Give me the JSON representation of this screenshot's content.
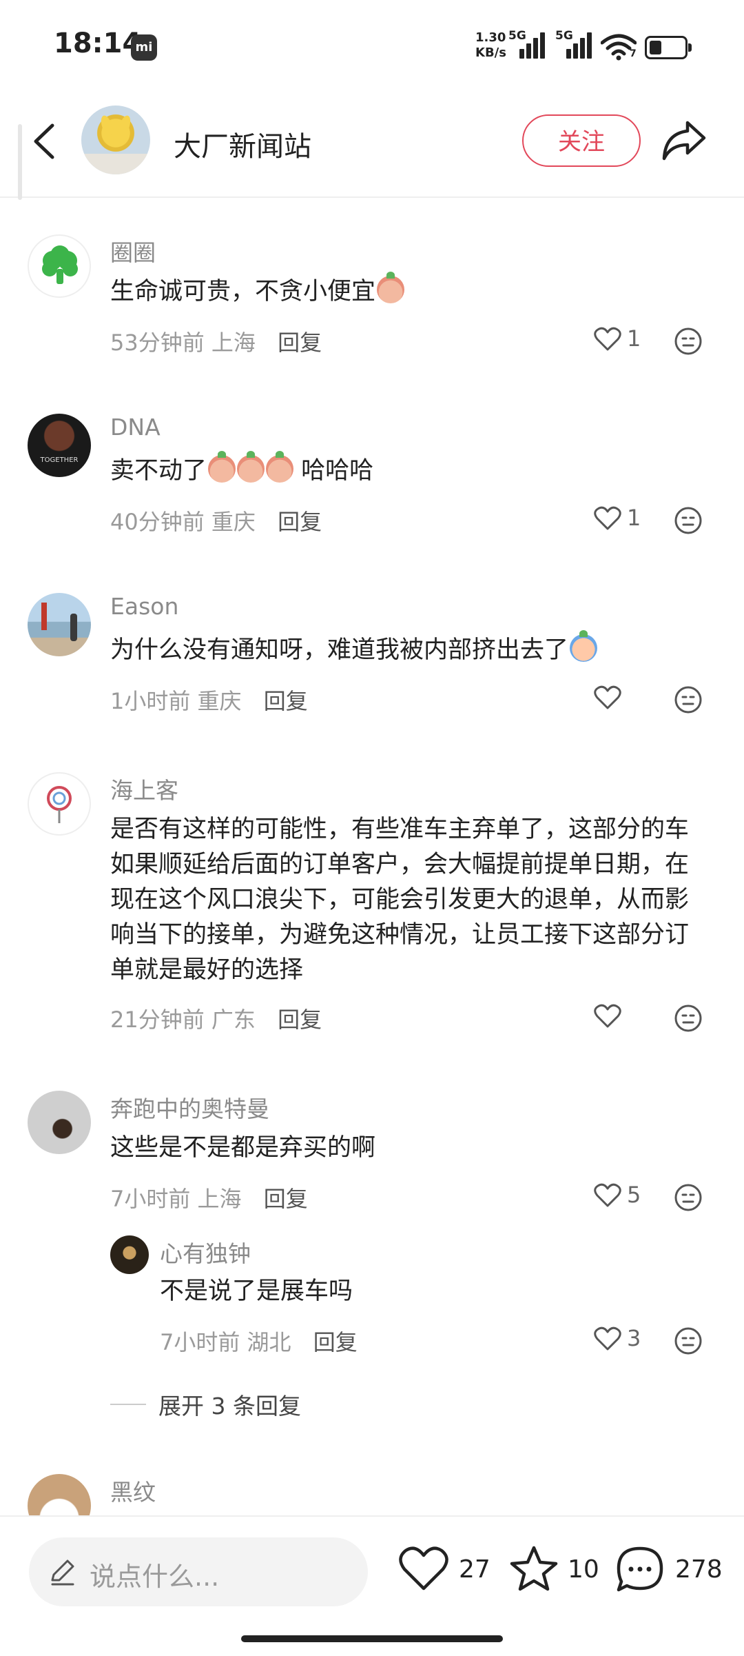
{
  "status_bar": {
    "time": "18:14",
    "mi_badge": "mi",
    "net_speed_value": "1.30",
    "net_speed_unit": "KB/s",
    "sim1_tag": "5G",
    "sim2_tag": "5G",
    "wifi_tag": "7",
    "battery_level": 0.35
  },
  "header": {
    "channel_name": "大厂新闻站",
    "follow_label": "关注"
  },
  "comments": [
    {
      "username": "圈圈",
      "text": "生命诚可贵，不贪小便宜",
      "time": "53分钟前",
      "location": "上海",
      "reply_label": "回复",
      "likes": "1"
    },
    {
      "username": "DNA",
      "text_before": "卖不动了",
      "text_after": "哈哈哈",
      "time": "40分钟前",
      "location": "重庆",
      "reply_label": "回复",
      "likes": "1"
    },
    {
      "username": "Eason",
      "text": "为什么没有通知呀，难道我被内部挤出去了",
      "time": "1小时前",
      "location": "重庆",
      "reply_label": "回复",
      "likes": ""
    },
    {
      "username": "海上客",
      "text": "是否有这样的可能性，有些准车主弃单了，这部分的车如果顺延给后面的订单客户，会大幅提前提单日期，在现在这个风口浪尖下，可能会引发更大的退单，从而影响当下的接单，为避免这种情况，让员工接下这部分订单就是最好的选择",
      "time": "21分钟前",
      "location": "广东",
      "reply_label": "回复",
      "likes": ""
    },
    {
      "username": "奔跑中的奥特曼",
      "text": "这些是不是都是弃买的啊",
      "time": "7小时前",
      "location": "上海",
      "reply_label": "回复",
      "likes": "5",
      "sub_reply": {
        "username": "心有独钟",
        "text": "不是说了是展车吗",
        "time": "7小时前",
        "location": "湖北",
        "reply_label": "回复",
        "likes": "3"
      },
      "expand_label": "展开 3 条回复"
    },
    {
      "username": "黑纹"
    }
  ],
  "bottom_bar": {
    "input_placeholder": "说点什么...",
    "likes_count": "27",
    "favorites_count": "10",
    "comments_count": "278"
  },
  "colors": {
    "accent": "#e2485a",
    "text_primary": "#222222",
    "text_secondary": "#8a8a8a"
  }
}
